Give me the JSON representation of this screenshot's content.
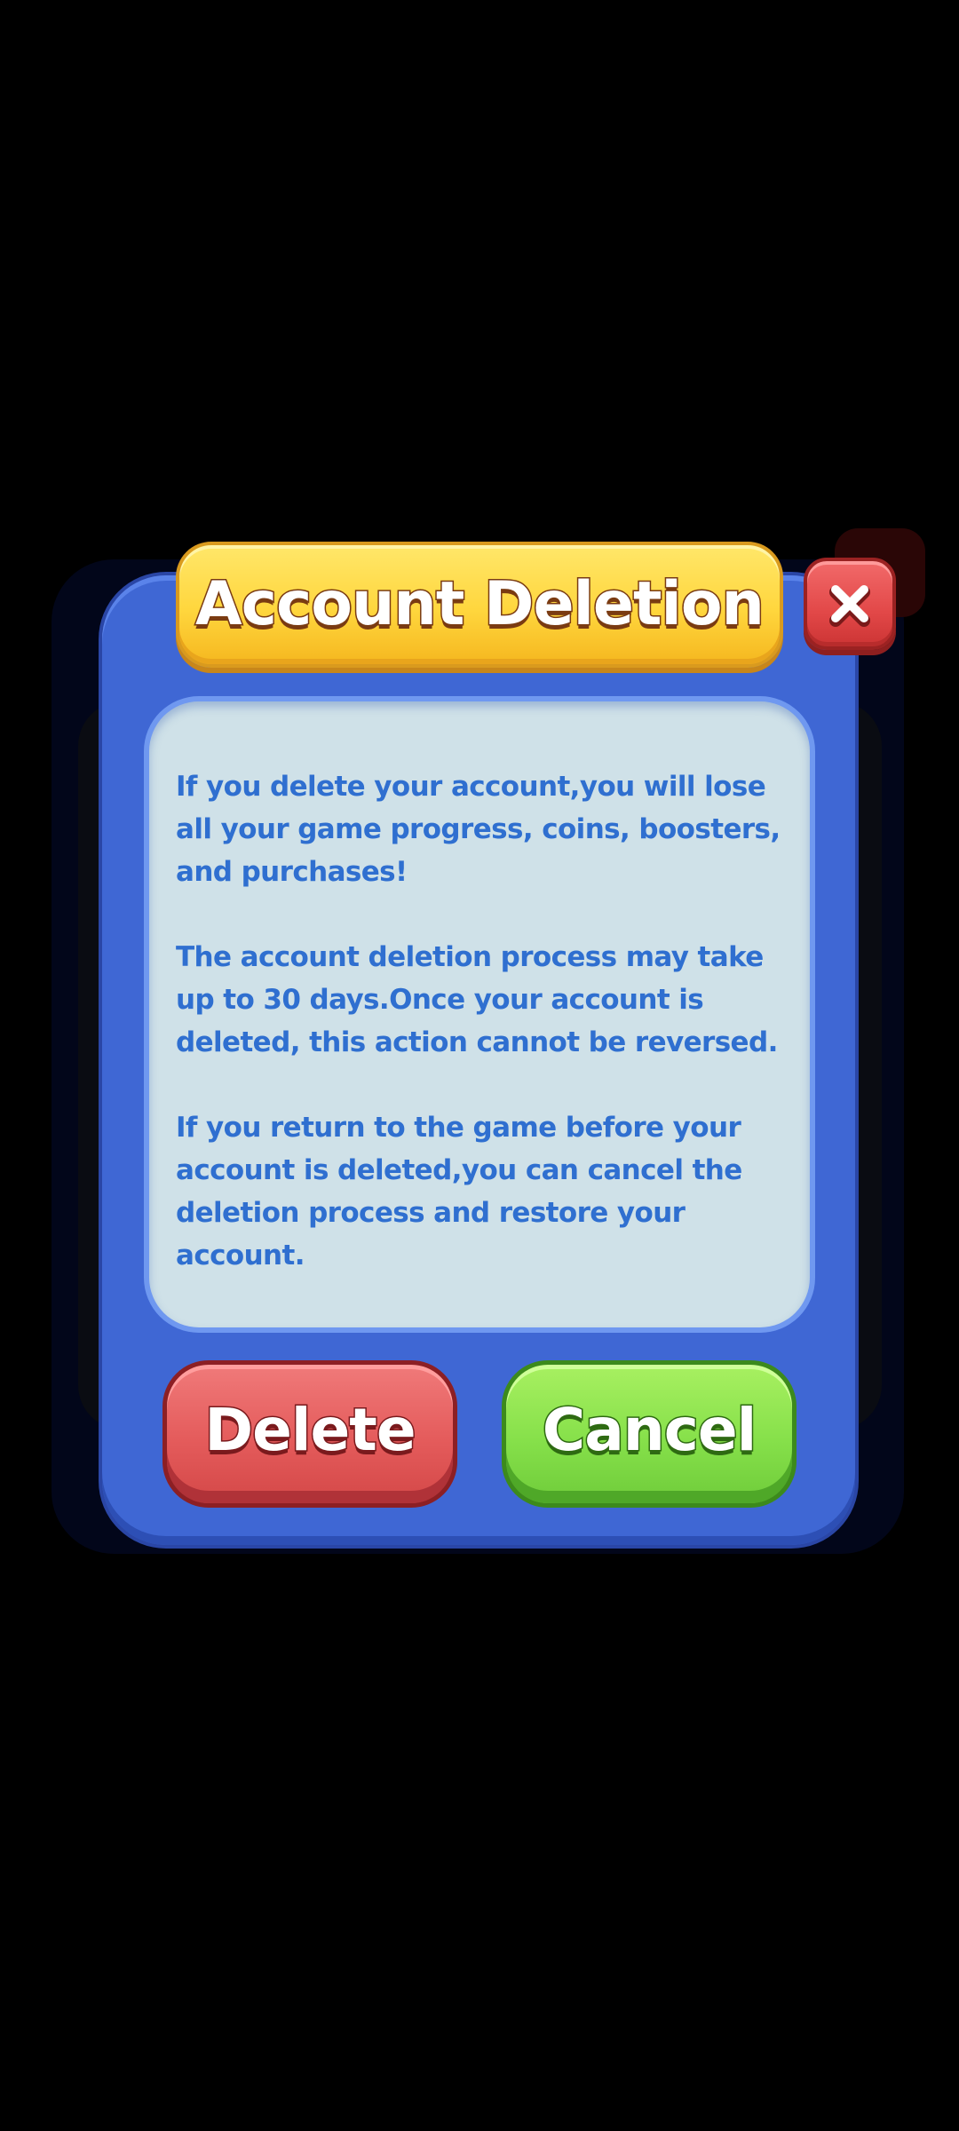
{
  "dialog": {
    "title": "Account Deletion",
    "close_icon": "close-icon",
    "paragraphs": [
      "If you delete your account,you will lose all your game progress, coins, boosters, and purchases!",
      "The account deletion process may take up to 30 days.Once your account is deleted, this action cannot be reversed.",
      "If you return to the game before your account is deleted,you can cancel the deletion process and restore your account."
    ],
    "delete_label": "Delete",
    "cancel_label": "Cancel"
  },
  "colors": {
    "panel": "#3f67d4",
    "title_banner": "#ffd63d",
    "text": "#2f6fd0",
    "delete_button": "#e45b5b",
    "cancel_button": "#86e04a",
    "close_button": "#e24848",
    "content_box": "#cfe1e8"
  }
}
